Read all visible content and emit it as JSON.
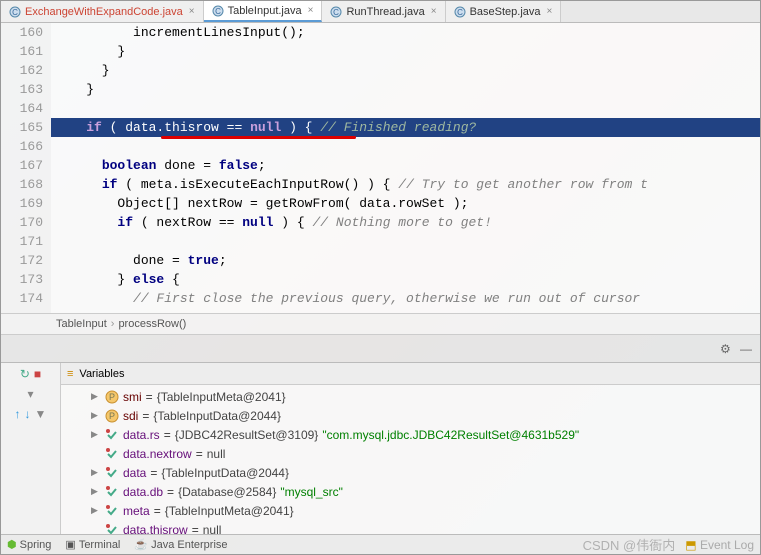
{
  "tabs": [
    {
      "icon": "#3b8",
      "label": "ExchangeWithExpandCode.java",
      "active": false,
      "color": "#c43"
    },
    {
      "icon": "#3b8",
      "label": "TableInput.java",
      "active": true,
      "color": "#333"
    },
    {
      "icon": "#3b8",
      "label": "RunThread.java",
      "active": false,
      "color": "#333"
    },
    {
      "icon": "#3b8",
      "label": "BaseStep.java",
      "active": false,
      "color": "#333"
    }
  ],
  "gutter": [
    "160",
    "161",
    "162",
    "163",
    "164",
    "165",
    "166",
    "167",
    "168",
    "169",
    "170",
    "171",
    "172",
    "173",
    "174"
  ],
  "code": {
    "l160": "          incrementLinesInput();",
    "l161": "        }",
    "l162": "      }",
    "l163": "    }",
    "l164": "",
    "l165_pre": "    ",
    "l165_if": "if",
    "l165_mid": " ( data.thisrow == ",
    "l165_null": "null",
    "l165_post": " ) { ",
    "l165_cm": "// Finished reading?",
    "l166": "",
    "l167_pre": "      ",
    "l167_kw": "boolean",
    "l167_mid": " done = ",
    "l167_kw2": "false",
    "l167_post": ";",
    "l168_pre": "      ",
    "l168_if": "if",
    "l168_mid": " ( meta.isExecuteEachInputRow() ) { ",
    "l168_cm": "// Try to get another row from t",
    "l169": "        Object[] nextRow = getRowFrom( data.rowSet );",
    "l170_pre": "        ",
    "l170_if": "if",
    "l170_mid": " ( nextRow == ",
    "l170_null": "null",
    "l170_post": " ) { ",
    "l170_cm": "// Nothing more to get!",
    "l171": "",
    "l172_pre": "          done = ",
    "l172_kw": "true",
    "l172_post": ";",
    "l173_pre": "        } ",
    "l173_kw": "else",
    "l173_post": " {",
    "l174_cm": "          // First close the previous query, otherwise we run out of cursor"
  },
  "breadcrumb": {
    "a": "TableInput",
    "b": "processRow()"
  },
  "varHeader": "Variables",
  "vars": [
    {
      "arrow": "▶",
      "icon": "p",
      "name": "smi",
      "eq": "=",
      "val": "{TableInputMeta@2041}"
    },
    {
      "arrow": "▶",
      "icon": "p",
      "name": "sdi",
      "eq": "=",
      "val": "{TableInputData@2044}"
    },
    {
      "arrow": "▶",
      "icon": "w",
      "name": "data.rs",
      "eq": "=",
      "val": "{JDBC42ResultSet@3109}",
      "str": " \"com.mysql.jdbc.JDBC42ResultSet@4631b529\""
    },
    {
      "arrow": "",
      "icon": "w",
      "name": "data.nextrow",
      "eq": "=",
      "val": "null"
    },
    {
      "arrow": "▶",
      "icon": "w",
      "name": "data",
      "eq": "=",
      "val": "{TableInputData@2044}"
    },
    {
      "arrow": "▶",
      "icon": "w",
      "name": "data.db",
      "eq": "=",
      "val": "{Database@2584}",
      "str": " \"mysql_src\""
    },
    {
      "arrow": "▶",
      "icon": "w",
      "name": "meta",
      "eq": "=",
      "val": "{TableInputMeta@2041}"
    },
    {
      "arrow": "",
      "icon": "w",
      "name": "data.thisrow",
      "eq": "=",
      "val": "null"
    }
  ],
  "bottom": {
    "spring": "Spring",
    "terminal": "Terminal",
    "java": "Java Enterprise",
    "eventlog": "Event Log"
  },
  "watermark": "CSDN @伟衙内"
}
